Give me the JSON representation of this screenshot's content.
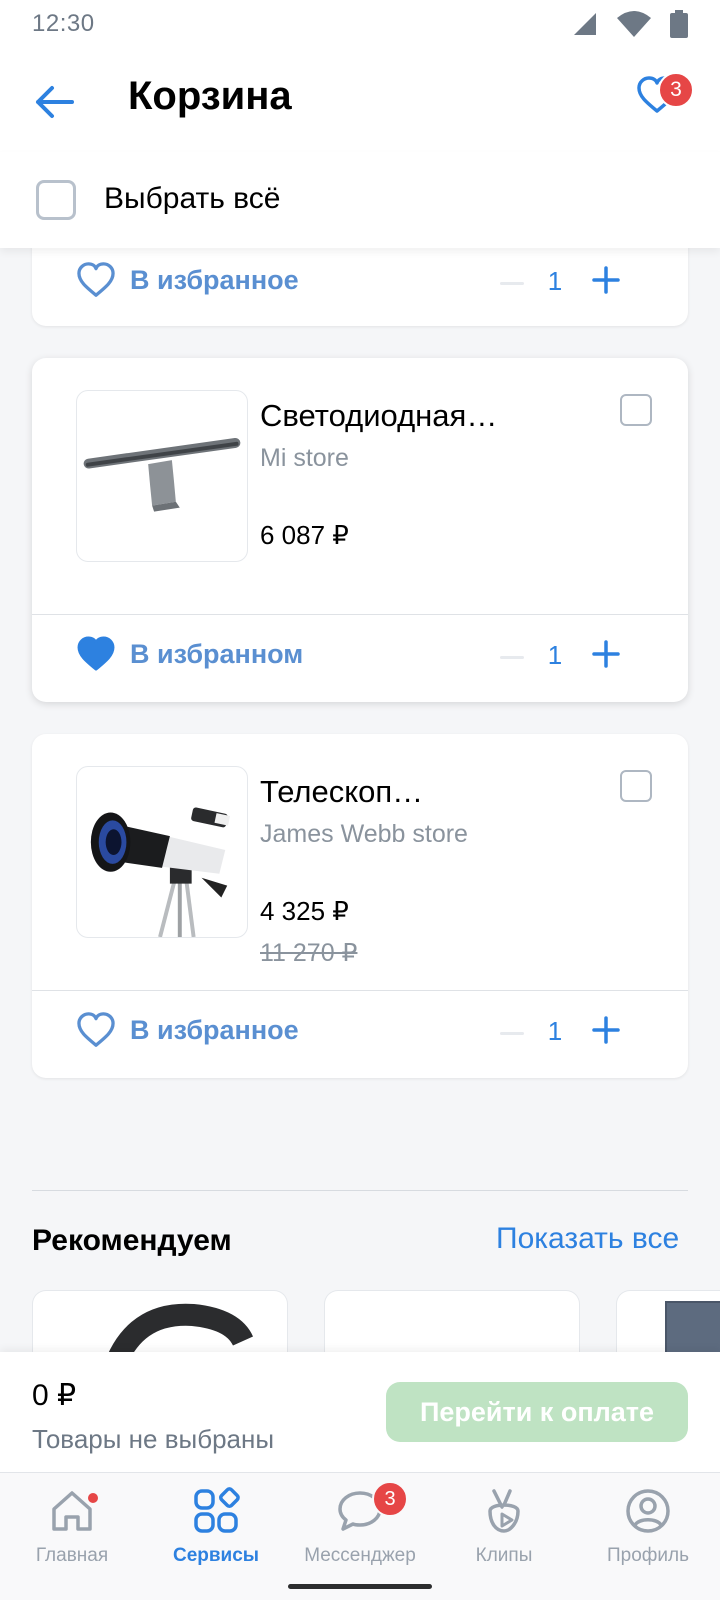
{
  "status_bar": {
    "time": "12:30"
  },
  "header": {
    "title": "Корзина",
    "favorites_badge": "3"
  },
  "select_all": {
    "label": "Выбрать всё"
  },
  "cart_items": [
    {
      "fav_label": "В избранное",
      "favorited": false,
      "quantity": "1"
    },
    {
      "title": "Светодиодная…",
      "store": "Mi store",
      "price": "6 087 ₽",
      "fav_label": "В избранном",
      "favorited": true,
      "quantity": "1",
      "image": "monitor-light-bar"
    },
    {
      "title": "Телескоп…",
      "store": "James Webb store",
      "price": "4 325 ₽",
      "old_price": "11 270 ₽",
      "fav_label": "В избранное",
      "favorited": false,
      "quantity": "1",
      "image": "telescope"
    }
  ],
  "recommendations": {
    "title": "Рекомендуем",
    "show_all": "Показать все"
  },
  "checkout": {
    "total": "0 ₽",
    "note": "Товары не выбраны",
    "button": "Перейти к оплате"
  },
  "tabbar": {
    "tabs": [
      {
        "label": "Главная",
        "icon": "home-icon"
      },
      {
        "label": "Сервисы",
        "icon": "services-icon",
        "active": true
      },
      {
        "label": "Мессенджер",
        "icon": "messenger-icon",
        "badge": "3"
      },
      {
        "label": "Клипы",
        "icon": "clips-icon"
      },
      {
        "label": "Профиль",
        "icon": "profile-icon"
      }
    ]
  },
  "colors": {
    "accent": "#2d81e0",
    "badge": "#e64646",
    "pay_disabled": "#bfe3c3"
  }
}
